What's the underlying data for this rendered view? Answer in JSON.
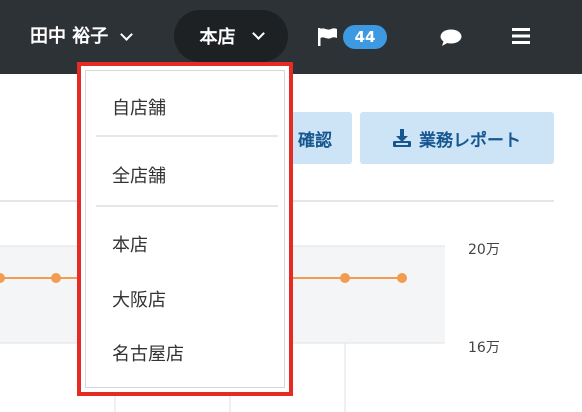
{
  "header": {
    "user_name": "田中 裕子",
    "store": "本店",
    "flag_count": "44",
    "icons": [
      "chevron-down-icon",
      "flag-icon",
      "chat-icon",
      "menu-icon"
    ],
    "background_color": "#2d3236",
    "badge_color": "#3d9ae2"
  },
  "toolbar": {
    "confirm_label": "確認",
    "report_label": "業務レポート",
    "report_icon": "download-icon",
    "button_color": "#cde4f6",
    "button_text_color": "#16578f"
  },
  "chart": {
    "y_labels": [
      "20万",
      "16万"
    ],
    "line_color": "#f19c4f"
  },
  "store_dropdown": {
    "sections": [
      [
        "自店舗"
      ],
      [
        "全店舗"
      ],
      [
        "本店",
        "大阪店",
        "名古屋店"
      ]
    ],
    "highlight_color": "#e52b24"
  }
}
